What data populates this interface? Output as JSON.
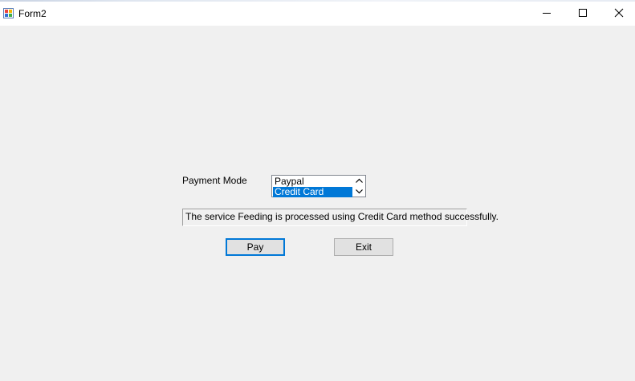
{
  "window": {
    "title": "Form2",
    "app_icon": "winforms-app-icon",
    "controls": {
      "minimize_icon": "minimize-icon",
      "maximize_icon": "maximize-icon",
      "close_icon": "close-icon"
    }
  },
  "form": {
    "payment_mode_label": "Payment Mode",
    "payment_modes": [
      {
        "label": "Paypal",
        "selected": false
      },
      {
        "label": "Credit Card",
        "selected": true
      }
    ],
    "result_text": "The service Feeding is processed using Credit Card method successfully.",
    "pay_button": "Pay",
    "exit_button": "Exit"
  },
  "colors": {
    "selection": "#0078d7",
    "background": "#f0f0f0",
    "button": "#e1e1e1"
  }
}
